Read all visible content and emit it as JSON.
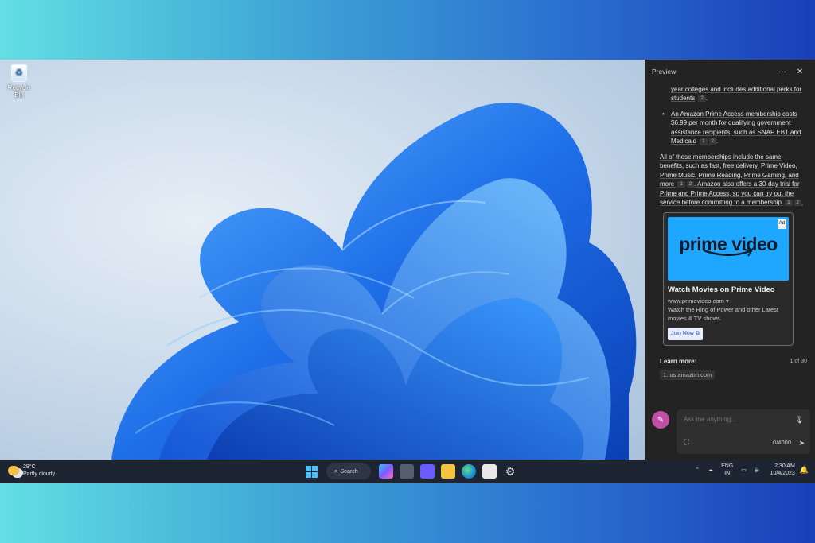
{
  "desktop": {
    "recycle_bin_label": "Recycle Bin"
  },
  "panel": {
    "title": "Preview",
    "more_label": "···",
    "close_label": "✕",
    "top_fragment": "Prime is for members enrolled in two- or four-year colleges and includes additional perks for students",
    "top_fragment_cite": "2",
    "bullet_access": "An Amazon Prime Access membership costs $6.99 per month for qualifying government assistance recipients, such as SNAP EBT and Medicaid",
    "bullet_access_cites": [
      "1",
      "2"
    ],
    "paragraph_a": "All of these memberships include the same benefits, such as fast, free delivery, Prime Video, Prime Music, Prime Reading, Prime Gaming, and more",
    "paragraph_a_cites": [
      "1",
      "2"
    ],
    "paragraph_b": ". Amazon also offers a 30-day trial for Prime and Prime Access, so you can try out the service before committing to a membership",
    "paragraph_b_cites": [
      "1",
      "2"
    ],
    "ad": {
      "tag": "Ad",
      "logo": "prime video",
      "title": "Watch Movies on Prime Video",
      "url": "www.primevideo.com ▾",
      "description": "Watch the Ring of Power and other Latest movies & TV shows.",
      "button": "Join Now ⧉"
    },
    "learn_more_label": "Learn more:",
    "pager": "1 of 30",
    "source_1": "1. us.amazon.com",
    "chat_placeholder": "Ask me anything...",
    "char_counter": "0/4000"
  },
  "taskbar": {
    "temperature": "29°C",
    "condition": "Partly cloudy",
    "search_label": "Search",
    "lang_top": "ENG",
    "lang_bottom": "IN",
    "time": "2:30 AM",
    "date": "10/4/2023"
  },
  "colors": {
    "accent": "#1ea7ff",
    "panel_bg": "#232323",
    "taskbar_bg": "#1e2532",
    "copilot_avatar": "#c04fa6"
  }
}
